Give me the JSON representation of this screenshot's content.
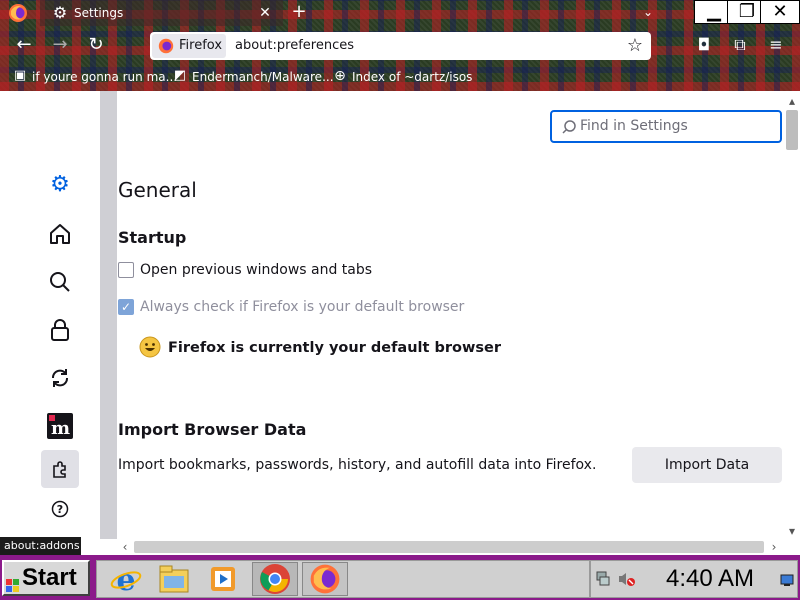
{
  "tab": {
    "title": "Settings"
  },
  "window": {
    "minimize": "▁",
    "restore": "❐",
    "close": "✕"
  },
  "urlbar": {
    "identity_label": "Firefox",
    "url": "about:preferences"
  },
  "bookmarks": [
    {
      "label": "if youre gonna run ma...",
      "icon": "bookmark-file-icon"
    },
    {
      "label": "Endermanch/Malware...",
      "icon": "github-icon"
    },
    {
      "label": "Index of ~dartz/isos",
      "icon": "globe-icon"
    }
  ],
  "search": {
    "placeholder": "Find in Settings"
  },
  "general": {
    "title": "General",
    "startup_heading": "Startup",
    "open_previous": {
      "label": "Open previous windows and tabs",
      "checked": false
    },
    "always_check": {
      "label": "Always check if Firefox is your default browser",
      "checked": true,
      "disabled": true
    },
    "default_status": "Firefox is currently your default browser",
    "import_heading": "Import Browser Data",
    "import_description": "Import bookmarks, passwords, history, and autofill data into Firefox.",
    "import_button": "Import Data"
  },
  "sidebar": {
    "items": [
      {
        "name": "general",
        "icon": "gear-icon"
      },
      {
        "name": "home",
        "icon": "home-icon"
      },
      {
        "name": "search",
        "icon": "search-icon"
      },
      {
        "name": "privacy",
        "icon": "lock-icon"
      },
      {
        "name": "sync",
        "icon": "sync-icon"
      },
      {
        "name": "more-from-mozilla",
        "icon": "mozilla-icon"
      },
      {
        "name": "extensions",
        "icon": "puzzle-icon"
      },
      {
        "name": "support",
        "icon": "help-icon"
      }
    ]
  },
  "tooltip": "about:addons",
  "taskbar": {
    "start_label": "Start",
    "clock": "4:40 AM",
    "apps": [
      "internet-explorer-icon",
      "file-explorer-icon",
      "media-player-icon",
      "chrome-icon",
      "firefox-icon"
    ]
  },
  "colors": {
    "accent": "#0061e0",
    "taskbar": "#8b1a8a"
  }
}
